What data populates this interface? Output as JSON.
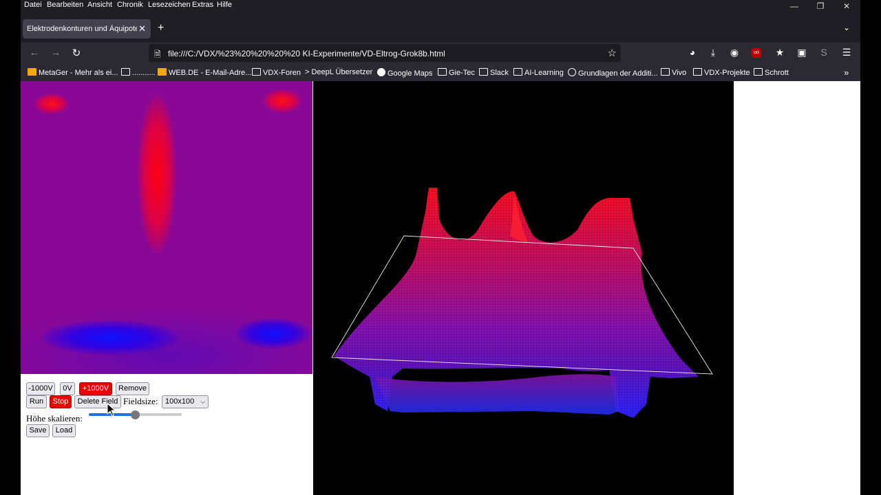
{
  "menu": {
    "items": [
      "Datei",
      "Bearbeiten",
      "Ansicht",
      "Chronik",
      "Lesezeichen",
      "Extras",
      "Hilfe"
    ]
  },
  "window_controls": {
    "minimize_icon": "minimize-icon",
    "restore_icon": "restore-icon",
    "close_icon": "close-icon"
  },
  "tab": {
    "title": "Elektrodenkonturen und Äquipoten",
    "close_icon": "close-icon"
  },
  "navbar": {
    "url": "file:///C:/VDX/%23%20%20%20%20 KI-Experimente/VD-Eltrog-Grok8b.html",
    "icons": [
      "back-arrow-icon",
      "forward-arrow-icon",
      "reload-icon",
      "bookmark-star-icon",
      "pocket-icon",
      "download-icon",
      "account-icon",
      "ublock-icon",
      "extension-icon",
      "puzzle-icon",
      "sync-icon",
      "menu-icon"
    ]
  },
  "bookmarks": [
    {
      "label": "MetaGer - Mehr als ei...",
      "icon": "metager-icon"
    },
    {
      "label": "...........",
      "icon": "folder-icon"
    },
    {
      "label": "WEB.DE - E-Mail-Adre...",
      "icon": "webde-icon"
    },
    {
      "label": "VDX-Foren",
      "icon": "folder-icon"
    },
    {
      "label": "DeepL Übersetzer",
      "icon": "deepl-icon"
    },
    {
      "label": "Google Maps",
      "icon": "google-icon"
    },
    {
      "label": "Gie-Tec",
      "icon": "folder-icon"
    },
    {
      "label": "Slack",
      "icon": "folder-icon"
    },
    {
      "label": "AI-Learning",
      "icon": "folder-icon"
    },
    {
      "label": "Grundlagen der Additi...",
      "icon": "globe-icon"
    },
    {
      "label": "Vivo",
      "icon": "folder-icon"
    },
    {
      "label": "VDX-Projekte",
      "icon": "folder-icon"
    },
    {
      "label": "Schrott",
      "icon": "folder-icon"
    }
  ],
  "controls": {
    "btn_minus": "-1000V",
    "btn_zero": "0V",
    "btn_plus": "+1000V",
    "btn_remove": "Remove",
    "btn_run": "Run",
    "btn_stop": "Stop",
    "btn_delete": "Delete Field",
    "fieldsize_label": "Fieldsize:",
    "fieldsize_value": "100x100",
    "scale_label": "Höhe skalieren:",
    "scale_slider_level": 0.5,
    "btn_save": "Save",
    "btn_load": "Load"
  },
  "colors": {
    "field_bg": "#8a0896",
    "positive": "#ff0000",
    "negative": "#0000ff",
    "active_button": "#ee0000",
    "slider_accent": "#1a73e8"
  }
}
